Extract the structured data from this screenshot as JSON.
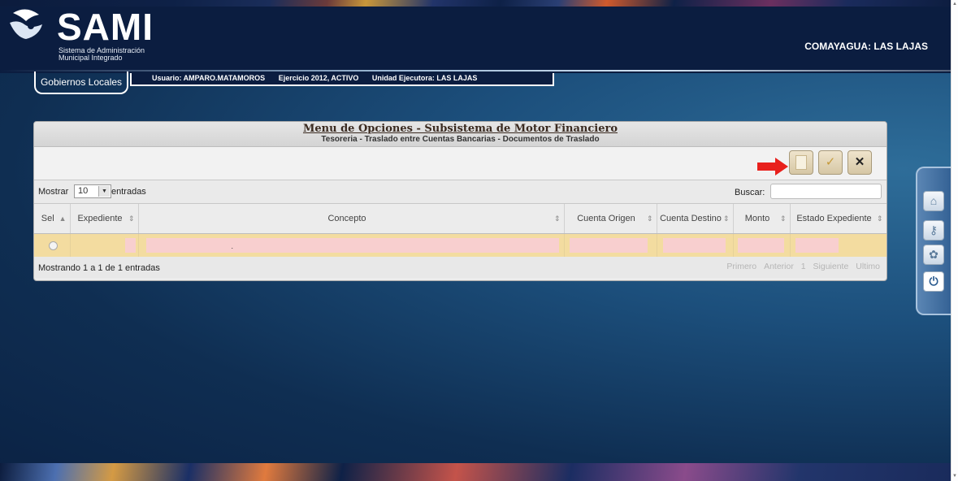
{
  "header": {
    "logo_text": "SAMI",
    "logo_subtitle_1": "Sistema de Administración",
    "logo_subtitle_2": "Municipal Integrado",
    "region": "COMAYAGUA: LAS LAJAS"
  },
  "tabs": {
    "gobiernos": "Gobiernos Locales"
  },
  "infobar": {
    "usuario": "Usuario: AMPARO.MATAMOROS",
    "ejercicio": "Ejercicio 2012, ACTIVO",
    "unidad": "Unidad Ejecutora: LAS LAJAS"
  },
  "panel": {
    "title": "Menu de Opciones - Subsistema de Motor Financiero",
    "subtitle": "Tesoreria - Traslado entre Cuentas Bancarias - Documentos de Traslado"
  },
  "toolbar": {
    "check_glyph": "✓",
    "cancel_glyph": "✕"
  },
  "controls": {
    "show_label": "Mostrar",
    "page_size": "10",
    "entries_label": "entradas",
    "search_label": "Buscar:",
    "search_value": ""
  },
  "table": {
    "columns": [
      "Sel",
      "Expediente",
      "Concepto",
      "Cuenta Origen",
      "Cuenta Destino",
      "Monto",
      "Estado Expediente"
    ],
    "sort_asc": "▲",
    "sort_both": "⇕",
    "row_dot": "."
  },
  "footer": {
    "info": "Mostrando 1 a 1 de 1 entradas",
    "first": "Primero",
    "prev": "Anterior",
    "page": "1",
    "next": "Siguiente",
    "last": "Ultimo"
  },
  "sidemenu": {
    "icons": [
      "home-icon",
      "key-icon",
      "certificate-icon",
      "power-icon"
    ]
  },
  "colors": {
    "row_highlight": "#f3dca0",
    "pink_cells": "#f8cfcf",
    "accent_arrow": "#e8201c"
  }
}
